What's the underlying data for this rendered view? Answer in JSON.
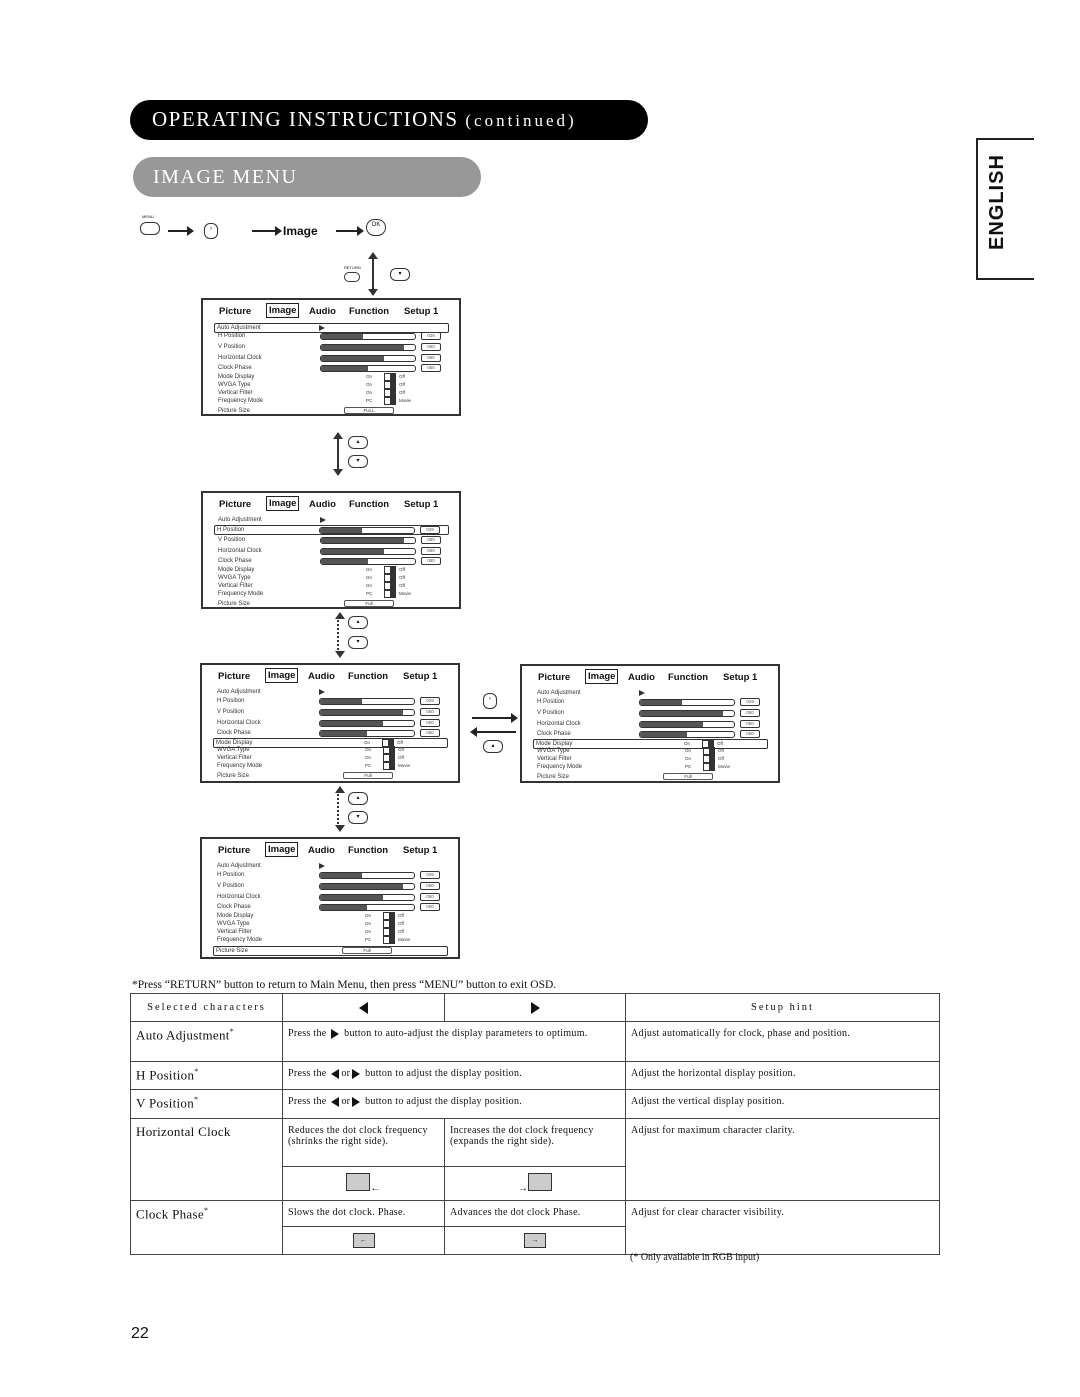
{
  "header": {
    "title": "OPERATING INSTRUCTIONS",
    "title_suffix": "(continued)",
    "section": "IMAGE MENU",
    "language_tab": "ENGLISH"
  },
  "nav_sequence": {
    "menu_button": "MENU",
    "target_label": "Image",
    "ok_button": "OK",
    "return_button": "RETURN"
  },
  "osd": {
    "tabs": [
      "Picture",
      "Image",
      "Audio",
      "Function",
      "Setup 1"
    ],
    "selected_tab": "Image",
    "items": [
      {
        "label": "Auto Adjustment"
      },
      {
        "label": "H Position",
        "value": "029",
        "level": 0.45
      },
      {
        "label": "V Position",
        "value": "050",
        "level": 0.88
      },
      {
        "label": "Horizontal Clock",
        "value": "050",
        "level": 0.67
      },
      {
        "label": "Clock Phase",
        "value": "050",
        "level": 0.5
      },
      {
        "label": "Mode Display",
        "opt_a": "On",
        "opt_b": "Off"
      },
      {
        "label": "WVGA Type",
        "opt_a": "On",
        "opt_b": "Off"
      },
      {
        "label": "Vertical Filter",
        "opt_a": "On",
        "opt_b": "Off"
      },
      {
        "label": "Frequency Mode",
        "opt_a": "PC",
        "opt_b": "Movie"
      },
      {
        "label": "Picture Size",
        "value": "Full"
      }
    ],
    "first_size_value": "FULL"
  },
  "note": "*Press “RETURN” button to return to Main Menu, then press “MENU” button to exit OSD.",
  "table": {
    "headers": {
      "selected": "Selected characters",
      "hint": "Setup hint"
    },
    "rows": [
      {
        "name": "Auto Adjustment",
        "mark": "*",
        "pre": "Press the",
        "post": "button to auto-adjust the display parameters to optimum.",
        "hint": "Adjust automatically for clock, phase and position."
      },
      {
        "name": "H Position",
        "mark": "*",
        "pre": "Press the",
        "mid": "or",
        "post": "button to adjust the display position.",
        "hint": "Adjust the horizontal display position."
      },
      {
        "name": "V Position",
        "mark": "*",
        "pre": "Press the",
        "mid": "or",
        "post": "button to adjust the display position.",
        "hint": "Adjust the vertical display position."
      },
      {
        "name": "Horizontal Clock",
        "left": "Reduces the dot clock frequency (shrinks the right side).",
        "right": "Increases the dot clock frequency (expands the right side).",
        "hint": "Adjust for maximum character clarity."
      },
      {
        "name": "Clock Phase",
        "mark": "*",
        "left": "Slows the dot clock. Phase.",
        "right": "Advances the dot clock Phase.",
        "hint": "Adjust for clear character visibility."
      }
    ],
    "footnote": "(* Only available in RGB input)"
  },
  "page_number": "22"
}
